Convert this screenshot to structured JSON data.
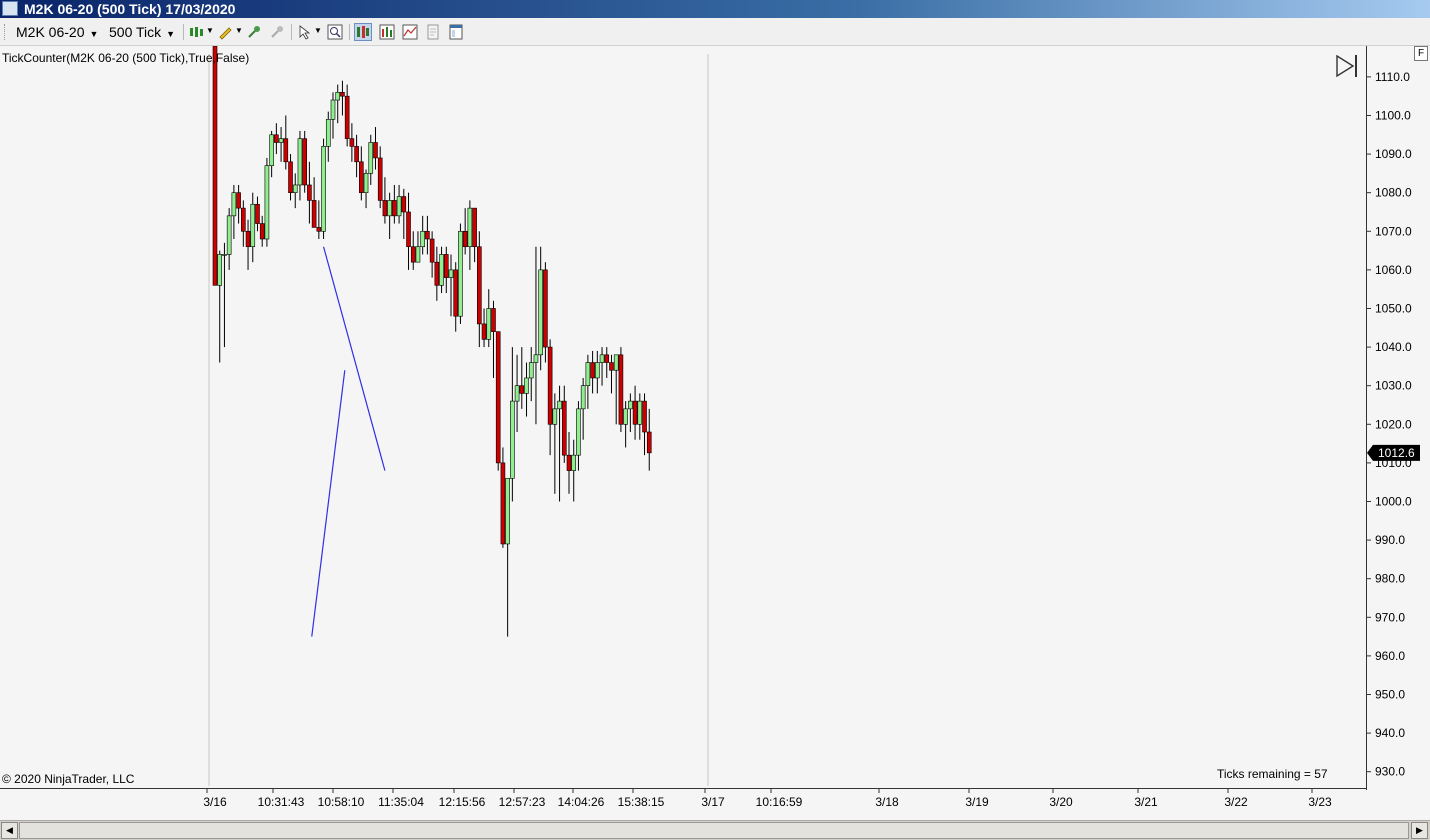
{
  "window": {
    "title": "M2K 06-20 (500 Tick)  17/03/2020"
  },
  "toolbar": {
    "instrument": "M2K 06-20",
    "interval": "500 Tick"
  },
  "chart": {
    "indicator_label": "TickCounter(M2K 06-20 (500 Tick),True,False)",
    "copyright": "© 2020 NinjaTrader, LLC",
    "ticks_remaining": "Ticks remaining = 57",
    "current_price_label": "1012.6",
    "f_button": "F",
    "colors": {
      "up": "#90ee90",
      "down": "#cc0000",
      "drawing": "#2f2fe6",
      "background": "#f5f5f5"
    }
  },
  "chart_data": {
    "type": "candlestick",
    "y_ticks": [
      "930.0",
      "940.0",
      "950.0",
      "960.0",
      "970.0",
      "980.0",
      "990.0",
      "1000.0",
      "1010.0",
      "1020.0",
      "1030.0",
      "1040.0",
      "1050.0",
      "1060.0",
      "1070.0",
      "1080.0",
      "1090.0",
      "1100.0",
      "1110.0"
    ],
    "ylim": [
      925,
      1118
    ],
    "x_labels": [
      "3/16",
      "10:31:43",
      "10:58:10",
      "11:35:04",
      "12:15:56",
      "12:57:23",
      "14:04:26",
      "15:38:15",
      "3/17",
      "10:16:59",
      "3/18",
      "3/19",
      "3/20",
      "3/21",
      "3/22",
      "3/23"
    ],
    "current_price": 1012.6,
    "candles": [
      [
        1118,
        1118,
        1056,
        1056
      ],
      [
        1056,
        1065,
        1036,
        1064
      ],
      [
        1064,
        1067,
        1040,
        1064
      ],
      [
        1064,
        1076,
        1060,
        1074
      ],
      [
        1074,
        1082,
        1068,
        1080
      ],
      [
        1080,
        1082,
        1072,
        1076
      ],
      [
        1076,
        1078,
        1066,
        1070
      ],
      [
        1070,
        1073,
        1060,
        1066
      ],
      [
        1066,
        1080,
        1062,
        1077
      ],
      [
        1077,
        1079,
        1070,
        1072
      ],
      [
        1072,
        1074,
        1066,
        1068
      ],
      [
        1068,
        1089,
        1066,
        1087
      ],
      [
        1087,
        1096,
        1084,
        1095
      ],
      [
        1095,
        1098,
        1090,
        1093
      ],
      [
        1093,
        1097,
        1088,
        1094
      ],
      [
        1094,
        1100,
        1086,
        1088
      ],
      [
        1088,
        1090,
        1078,
        1080
      ],
      [
        1080,
        1085,
        1076,
        1082
      ],
      [
        1082,
        1096,
        1078,
        1094
      ],
      [
        1094,
        1096,
        1080,
        1082
      ],
      [
        1082,
        1088,
        1072,
        1078
      ],
      [
        1078,
        1084,
        1072,
        1071
      ],
      [
        1071,
        1078,
        1068,
        1070
      ],
      [
        1070,
        1094,
        1068,
        1092
      ],
      [
        1092,
        1101,
        1088,
        1099
      ],
      [
        1099,
        1106,
        1094,
        1104
      ],
      [
        1104,
        1108,
        1098,
        1106
      ],
      [
        1106,
        1109,
        1100,
        1105
      ],
      [
        1105,
        1108,
        1092,
        1094
      ],
      [
        1094,
        1098,
        1088,
        1092
      ],
      [
        1092,
        1095,
        1084,
        1088
      ],
      [
        1088,
        1092,
        1078,
        1080
      ],
      [
        1080,
        1086,
        1076,
        1085
      ],
      [
        1085,
        1095,
        1082,
        1093
      ],
      [
        1093,
        1097,
        1086,
        1089
      ],
      [
        1089,
        1092,
        1076,
        1078
      ],
      [
        1078,
        1084,
        1072,
        1074
      ],
      [
        1074,
        1080,
        1068,
        1078
      ],
      [
        1078,
        1082,
        1072,
        1074
      ],
      [
        1074,
        1082,
        1072,
        1079
      ],
      [
        1079,
        1081,
        1068,
        1075
      ],
      [
        1075,
        1080,
        1060,
        1066
      ],
      [
        1066,
        1070,
        1060,
        1062
      ],
      [
        1062,
        1070,
        1062,
        1066
      ],
      [
        1066,
        1074,
        1064,
        1070
      ],
      [
        1070,
        1074,
        1064,
        1068
      ],
      [
        1068,
        1070,
        1058,
        1062
      ],
      [
        1062,
        1066,
        1052,
        1056
      ],
      [
        1056,
        1066,
        1054,
        1064
      ],
      [
        1064,
        1066,
        1054,
        1058
      ],
      [
        1058,
        1064,
        1048,
        1060
      ],
      [
        1060,
        1062,
        1044,
        1048
      ],
      [
        1048,
        1072,
        1046,
        1070
      ],
      [
        1070,
        1076,
        1064,
        1066
      ],
      [
        1066,
        1078,
        1060,
        1076
      ],
      [
        1076,
        1076,
        1062,
        1066
      ],
      [
        1066,
        1070,
        1040,
        1046
      ],
      [
        1046,
        1050,
        1040,
        1042
      ],
      [
        1042,
        1055,
        1040,
        1050
      ],
      [
        1050,
        1052,
        1032,
        1044
      ],
      [
        1044,
        1044,
        1008,
        1010
      ],
      [
        1010,
        1014,
        988,
        989
      ],
      [
        989,
        1006,
        965,
        1006
      ],
      [
        1006,
        1040,
        1000,
        1026
      ],
      [
        1026,
        1038,
        1018,
        1030
      ],
      [
        1030,
        1040,
        1024,
        1028
      ],
      [
        1028,
        1036,
        1022,
        1032
      ],
      [
        1032,
        1040,
        1026,
        1036
      ],
      [
        1036,
        1066,
        1020,
        1038
      ],
      [
        1038,
        1066,
        1034,
        1060
      ],
      [
        1060,
        1062,
        1036,
        1040
      ],
      [
        1040,
        1042,
        1012,
        1020
      ],
      [
        1020,
        1028,
        1002,
        1024
      ],
      [
        1024,
        1030,
        1000,
        1026
      ],
      [
        1026,
        1030,
        1010,
        1012
      ],
      [
        1012,
        1018,
        1002,
        1008
      ],
      [
        1008,
        1016,
        1000,
        1012
      ],
      [
        1012,
        1026,
        1008,
        1024
      ],
      [
        1024,
        1032,
        1016,
        1030
      ],
      [
        1030,
        1038,
        1024,
        1036
      ],
      [
        1036,
        1039,
        1028,
        1032
      ],
      [
        1032,
        1039,
        1028,
        1036
      ],
      [
        1036,
        1040,
        1030,
        1038
      ],
      [
        1038,
        1040,
        1032,
        1036
      ],
      [
        1036,
        1038,
        1028,
        1034
      ],
      [
        1034,
        1038,
        1020,
        1038
      ],
      [
        1038,
        1040,
        1018,
        1020
      ],
      [
        1020,
        1026,
        1014,
        1024
      ],
      [
        1024,
        1028,
        1018,
        1026
      ],
      [
        1026,
        1030,
        1016,
        1020
      ],
      [
        1020,
        1028,
        1016,
        1026
      ],
      [
        1026,
        1028,
        1012,
        1018
      ],
      [
        1018,
        1024,
        1008,
        1012.6
      ]
    ],
    "drawings": [
      {
        "type": "line",
        "from": [
          23,
          1066
        ],
        "to": [
          36,
          1008
        ]
      },
      {
        "type": "line",
        "from": [
          20.5,
          965
        ],
        "to": [
          27.5,
          1034
        ]
      }
    ]
  }
}
